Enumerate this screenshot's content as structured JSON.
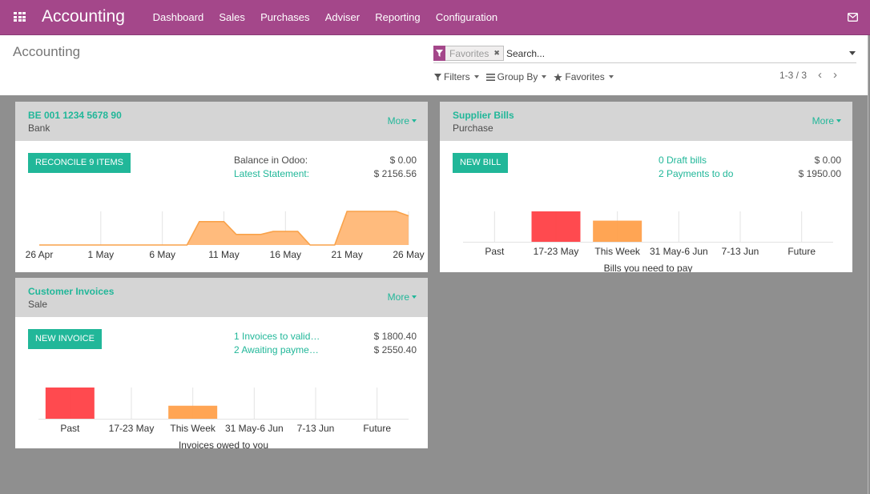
{
  "navbar": {
    "brand": "Accounting",
    "menu": [
      {
        "label": "Dashboard"
      },
      {
        "label": "Sales"
      },
      {
        "label": "Purchases"
      },
      {
        "label": "Adviser"
      },
      {
        "label": "Reporting"
      },
      {
        "label": "Configuration"
      }
    ],
    "icons": {
      "apps": "apps-grid-icon",
      "messages": "envelope-icon"
    }
  },
  "control_panel": {
    "title": "Accounting",
    "search": {
      "facet_label": "Favorites",
      "facet_icon": "filter-icon",
      "facet_remove": "✖",
      "placeholder": "Search...",
      "value": ""
    },
    "filters_label": "Filters",
    "group_by_label": "Group By",
    "favorites_label": "Favorites",
    "pager": {
      "text": "1-3 / 3",
      "prev": "‹",
      "next": "›"
    }
  },
  "colors": {
    "brand": "#a4478a",
    "accent": "#21b799",
    "overdue": "#ff4046",
    "upcoming": "#ffa04b",
    "area_fill": "#ffbb7d",
    "area_stroke": "#f9a24a",
    "background": "#8f8f8f"
  },
  "journals": [
    {
      "title": "BE 001 1234 5678 90",
      "type": "Bank",
      "more": "More",
      "action": "RECONCILE 9 ITEMS",
      "stats": [
        {
          "label": "Balance in Odoo:",
          "value": "$ 0.00",
          "link": false
        },
        {
          "label": "Latest Statement:",
          "value": "$ 2156.56",
          "link": true
        }
      ]
    },
    {
      "title": "Supplier Bills",
      "type": "Purchase",
      "more": "More",
      "action": "NEW BILL",
      "stats": [
        {
          "label": "0 Draft bills",
          "value": "$ 0.00",
          "link": true
        },
        {
          "label": "2 Payments to do",
          "value": "$ 1950.00",
          "link": true
        }
      ]
    },
    {
      "title": "Customer Invoices",
      "type": "Sale",
      "more": "More",
      "action": "NEW INVOICE",
      "stats": [
        {
          "label": "1 Invoices to valid…",
          "value": "$ 1800.40",
          "link": true
        },
        {
          "label": "2 Awaiting payme…",
          "value": "$ 2550.40",
          "link": true
        }
      ]
    }
  ],
  "chart_data": [
    {
      "type": "area",
      "title": "",
      "xlabel": "",
      "ylabel": "",
      "xlim": [
        0,
        30
      ],
      "ylim": [
        0,
        2160
      ],
      "grid": true,
      "legend": "none",
      "x_ticks": [
        {
          "day": 0,
          "label": "26 Apr"
        },
        {
          "day": 5,
          "label": "1 May"
        },
        {
          "day": 10,
          "label": "6 May"
        },
        {
          "day": 15,
          "label": "11 May"
        },
        {
          "day": 20,
          "label": "16 May"
        },
        {
          "day": 25,
          "label": "21 May"
        },
        {
          "day": 30,
          "label": "26 May"
        }
      ],
      "points": [
        {
          "day": 0,
          "date": "26 Apr",
          "value": 0
        },
        {
          "day": 12,
          "date": "8 May",
          "value": 0
        },
        {
          "day": 13,
          "date": "9 May",
          "value": 1500
        },
        {
          "day": 15,
          "date": "11 May",
          "value": 1500
        },
        {
          "day": 16,
          "date": "12 May",
          "value": 680
        },
        {
          "day": 18,
          "date": "14 May",
          "value": 680
        },
        {
          "day": 19,
          "date": "15 May",
          "value": 870
        },
        {
          "day": 21,
          "date": "17 May",
          "value": 870
        },
        {
          "day": 22,
          "date": "18 May",
          "value": 0
        },
        {
          "day": 24,
          "date": "20 May",
          "value": 0
        },
        {
          "day": 25,
          "date": "21 May",
          "value": 2160
        },
        {
          "day": 29,
          "date": "25 May",
          "value": 2160
        },
        {
          "day": 30,
          "date": "26 May",
          "value": 1870
        }
      ]
    },
    {
      "type": "bar",
      "title": "Bills you need to pay",
      "xlabel": "",
      "ylabel": "",
      "categories": [
        "Past",
        "17-23 May",
        "This Week",
        "31 May-6 Jun",
        "7-13 Jun",
        "Future"
      ],
      "values": [
        0,
        1150,
        800,
        0,
        0,
        0
      ],
      "bar_colors": [
        "#ff4046",
        "#ff4046",
        "#ffa04b",
        "#ffa04b",
        "#ffa04b",
        "#ffa04b"
      ],
      "ylim": [
        0,
        1150
      ],
      "grid": true,
      "legend": "none"
    },
    {
      "type": "bar",
      "title": "Invoices owed to you",
      "xlabel": "",
      "ylabel": "",
      "categories": [
        "Past",
        "17-23 May",
        "This Week",
        "31 May-6 Jun",
        "7-13 Jun",
        "Future"
      ],
      "values": [
        1800.4,
        0,
        750.0,
        0,
        0,
        0
      ],
      "bar_colors": [
        "#ff4046",
        "#ff4046",
        "#ffa04b",
        "#ffa04b",
        "#ffa04b",
        "#ffa04b"
      ],
      "ylim": [
        0,
        1800.4
      ],
      "grid": true,
      "legend": "none"
    }
  ]
}
